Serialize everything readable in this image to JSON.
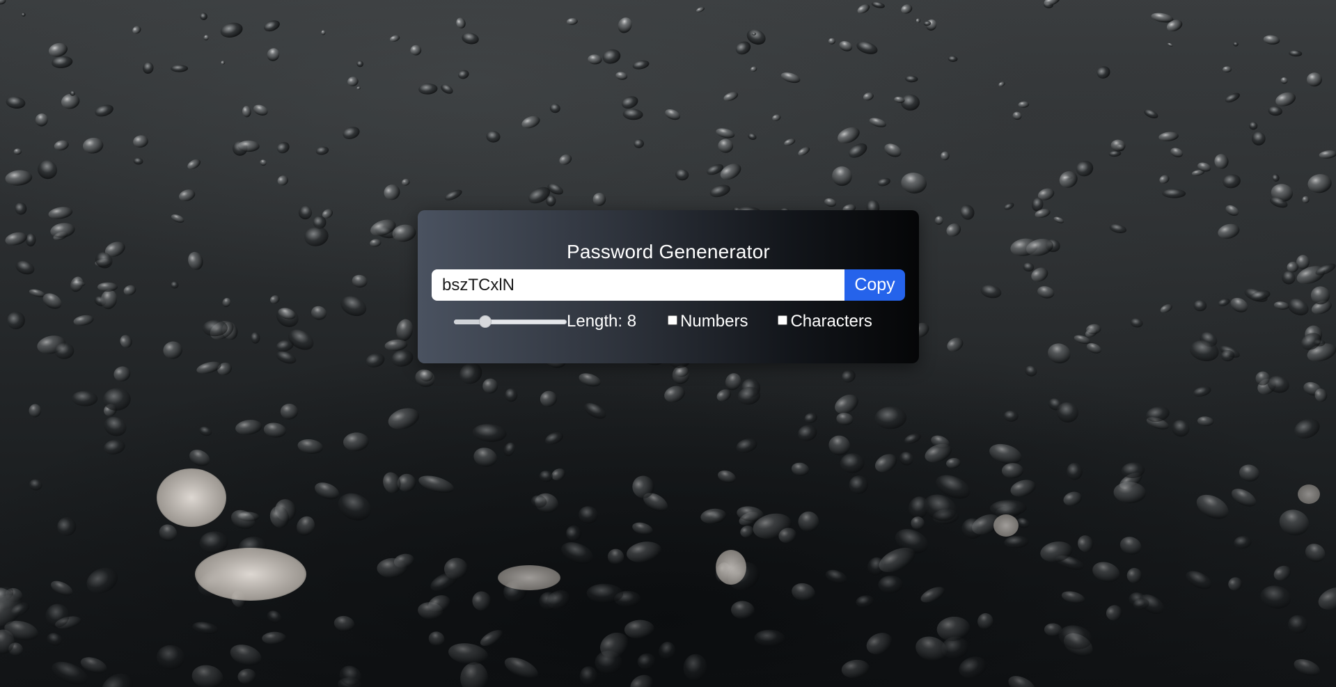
{
  "app": {
    "title": "Password Genenerator"
  },
  "password": {
    "value": "bszTCxlN"
  },
  "copy_button": {
    "label": "Copy"
  },
  "length": {
    "label": "Length: 8",
    "value": 8,
    "slider_fraction": 0.25
  },
  "options": {
    "numbers": {
      "label": "Numbers",
      "checked": false
    },
    "characters": {
      "label": "Characters",
      "checked": false
    }
  },
  "colors": {
    "accent": "#2563eb",
    "card_gradient_start": "#4a5260",
    "card_gradient_end": "#050607",
    "text": "#ffffff"
  },
  "icons": {
    "background": "water-droplets-background"
  }
}
